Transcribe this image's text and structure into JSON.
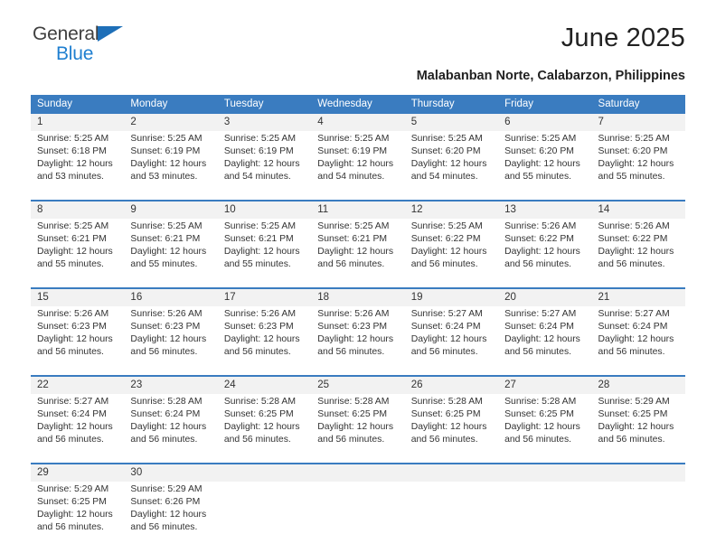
{
  "brand": {
    "name_part1": "General",
    "name_part2": "Blue",
    "triangle_icon": "triangle-icon",
    "accent_color": "#1f7fd0"
  },
  "header": {
    "title": "June 2025",
    "subtitle": "Malabanban Norte, Calabarzon, Philippines"
  },
  "calendar": {
    "header_bg": "#3a7cc0",
    "daynum_bg": "#f2f2f2",
    "weekdays": [
      "Sunday",
      "Monday",
      "Tuesday",
      "Wednesday",
      "Thursday",
      "Friday",
      "Saturday"
    ],
    "weeks": [
      [
        {
          "day": "1",
          "sunrise": "Sunrise: 5:25 AM",
          "sunset": "Sunset: 6:18 PM",
          "daylight": "Daylight: 12 hours and 53 minutes."
        },
        {
          "day": "2",
          "sunrise": "Sunrise: 5:25 AM",
          "sunset": "Sunset: 6:19 PM",
          "daylight": "Daylight: 12 hours and 53 minutes."
        },
        {
          "day": "3",
          "sunrise": "Sunrise: 5:25 AM",
          "sunset": "Sunset: 6:19 PM",
          "daylight": "Daylight: 12 hours and 54 minutes."
        },
        {
          "day": "4",
          "sunrise": "Sunrise: 5:25 AM",
          "sunset": "Sunset: 6:19 PM",
          "daylight": "Daylight: 12 hours and 54 minutes."
        },
        {
          "day": "5",
          "sunrise": "Sunrise: 5:25 AM",
          "sunset": "Sunset: 6:20 PM",
          "daylight": "Daylight: 12 hours and 54 minutes."
        },
        {
          "day": "6",
          "sunrise": "Sunrise: 5:25 AM",
          "sunset": "Sunset: 6:20 PM",
          "daylight": "Daylight: 12 hours and 55 minutes."
        },
        {
          "day": "7",
          "sunrise": "Sunrise: 5:25 AM",
          "sunset": "Sunset: 6:20 PM",
          "daylight": "Daylight: 12 hours and 55 minutes."
        }
      ],
      [
        {
          "day": "8",
          "sunrise": "Sunrise: 5:25 AM",
          "sunset": "Sunset: 6:21 PM",
          "daylight": "Daylight: 12 hours and 55 minutes."
        },
        {
          "day": "9",
          "sunrise": "Sunrise: 5:25 AM",
          "sunset": "Sunset: 6:21 PM",
          "daylight": "Daylight: 12 hours and 55 minutes."
        },
        {
          "day": "10",
          "sunrise": "Sunrise: 5:25 AM",
          "sunset": "Sunset: 6:21 PM",
          "daylight": "Daylight: 12 hours and 55 minutes."
        },
        {
          "day": "11",
          "sunrise": "Sunrise: 5:25 AM",
          "sunset": "Sunset: 6:21 PM",
          "daylight": "Daylight: 12 hours and 56 minutes."
        },
        {
          "day": "12",
          "sunrise": "Sunrise: 5:25 AM",
          "sunset": "Sunset: 6:22 PM",
          "daylight": "Daylight: 12 hours and 56 minutes."
        },
        {
          "day": "13",
          "sunrise": "Sunrise: 5:26 AM",
          "sunset": "Sunset: 6:22 PM",
          "daylight": "Daylight: 12 hours and 56 minutes."
        },
        {
          "day": "14",
          "sunrise": "Sunrise: 5:26 AM",
          "sunset": "Sunset: 6:22 PM",
          "daylight": "Daylight: 12 hours and 56 minutes."
        }
      ],
      [
        {
          "day": "15",
          "sunrise": "Sunrise: 5:26 AM",
          "sunset": "Sunset: 6:23 PM",
          "daylight": "Daylight: 12 hours and 56 minutes."
        },
        {
          "day": "16",
          "sunrise": "Sunrise: 5:26 AM",
          "sunset": "Sunset: 6:23 PM",
          "daylight": "Daylight: 12 hours and 56 minutes."
        },
        {
          "day": "17",
          "sunrise": "Sunrise: 5:26 AM",
          "sunset": "Sunset: 6:23 PM",
          "daylight": "Daylight: 12 hours and 56 minutes."
        },
        {
          "day": "18",
          "sunrise": "Sunrise: 5:26 AM",
          "sunset": "Sunset: 6:23 PM",
          "daylight": "Daylight: 12 hours and 56 minutes."
        },
        {
          "day": "19",
          "sunrise": "Sunrise: 5:27 AM",
          "sunset": "Sunset: 6:24 PM",
          "daylight": "Daylight: 12 hours and 56 minutes."
        },
        {
          "day": "20",
          "sunrise": "Sunrise: 5:27 AM",
          "sunset": "Sunset: 6:24 PM",
          "daylight": "Daylight: 12 hours and 56 minutes."
        },
        {
          "day": "21",
          "sunrise": "Sunrise: 5:27 AM",
          "sunset": "Sunset: 6:24 PM",
          "daylight": "Daylight: 12 hours and 56 minutes."
        }
      ],
      [
        {
          "day": "22",
          "sunrise": "Sunrise: 5:27 AM",
          "sunset": "Sunset: 6:24 PM",
          "daylight": "Daylight: 12 hours and 56 minutes."
        },
        {
          "day": "23",
          "sunrise": "Sunrise: 5:28 AM",
          "sunset": "Sunset: 6:24 PM",
          "daylight": "Daylight: 12 hours and 56 minutes."
        },
        {
          "day": "24",
          "sunrise": "Sunrise: 5:28 AM",
          "sunset": "Sunset: 6:25 PM",
          "daylight": "Daylight: 12 hours and 56 minutes."
        },
        {
          "day": "25",
          "sunrise": "Sunrise: 5:28 AM",
          "sunset": "Sunset: 6:25 PM",
          "daylight": "Daylight: 12 hours and 56 minutes."
        },
        {
          "day": "26",
          "sunrise": "Sunrise: 5:28 AM",
          "sunset": "Sunset: 6:25 PM",
          "daylight": "Daylight: 12 hours and 56 minutes."
        },
        {
          "day": "27",
          "sunrise": "Sunrise: 5:28 AM",
          "sunset": "Sunset: 6:25 PM",
          "daylight": "Daylight: 12 hours and 56 minutes."
        },
        {
          "day": "28",
          "sunrise": "Sunrise: 5:29 AM",
          "sunset": "Sunset: 6:25 PM",
          "daylight": "Daylight: 12 hours and 56 minutes."
        }
      ],
      [
        {
          "day": "29",
          "sunrise": "Sunrise: 5:29 AM",
          "sunset": "Sunset: 6:25 PM",
          "daylight": "Daylight: 12 hours and 56 minutes."
        },
        {
          "day": "30",
          "sunrise": "Sunrise: 5:29 AM",
          "sunset": "Sunset: 6:26 PM",
          "daylight": "Daylight: 12 hours and 56 minutes."
        },
        {
          "day": "",
          "sunrise": "",
          "sunset": "",
          "daylight": ""
        },
        {
          "day": "",
          "sunrise": "",
          "sunset": "",
          "daylight": ""
        },
        {
          "day": "",
          "sunrise": "",
          "sunset": "",
          "daylight": ""
        },
        {
          "day": "",
          "sunrise": "",
          "sunset": "",
          "daylight": ""
        },
        {
          "day": "",
          "sunrise": "",
          "sunset": "",
          "daylight": ""
        }
      ]
    ]
  }
}
